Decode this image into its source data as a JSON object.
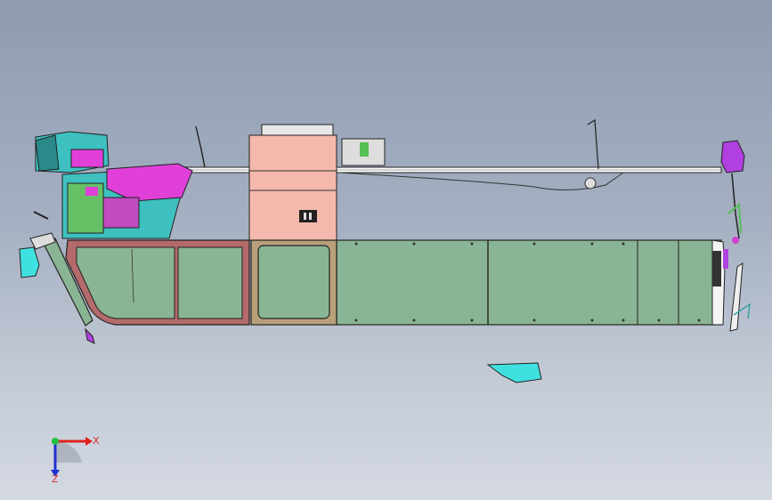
{
  "triad": {
    "x_label": "X",
    "z_label": "Z",
    "x_color": "#e02020",
    "z_color": "#2030d0",
    "y_color": "#20c040"
  },
  "colors": {
    "body_panel": "#8ab594",
    "cab_frame": "#b46a6a",
    "door": "#8ab594",
    "door_frame": "#b8a07a",
    "cabinet": "#f4b8ac",
    "dash_magenta": "#e040d8",
    "dash_cyan": "#30d0d0",
    "roof_rail": "#ffffff",
    "mirror": "#40e0e0",
    "rear_light": "#b040e0"
  },
  "icons": [
    "coordinate-triad-icon"
  ]
}
